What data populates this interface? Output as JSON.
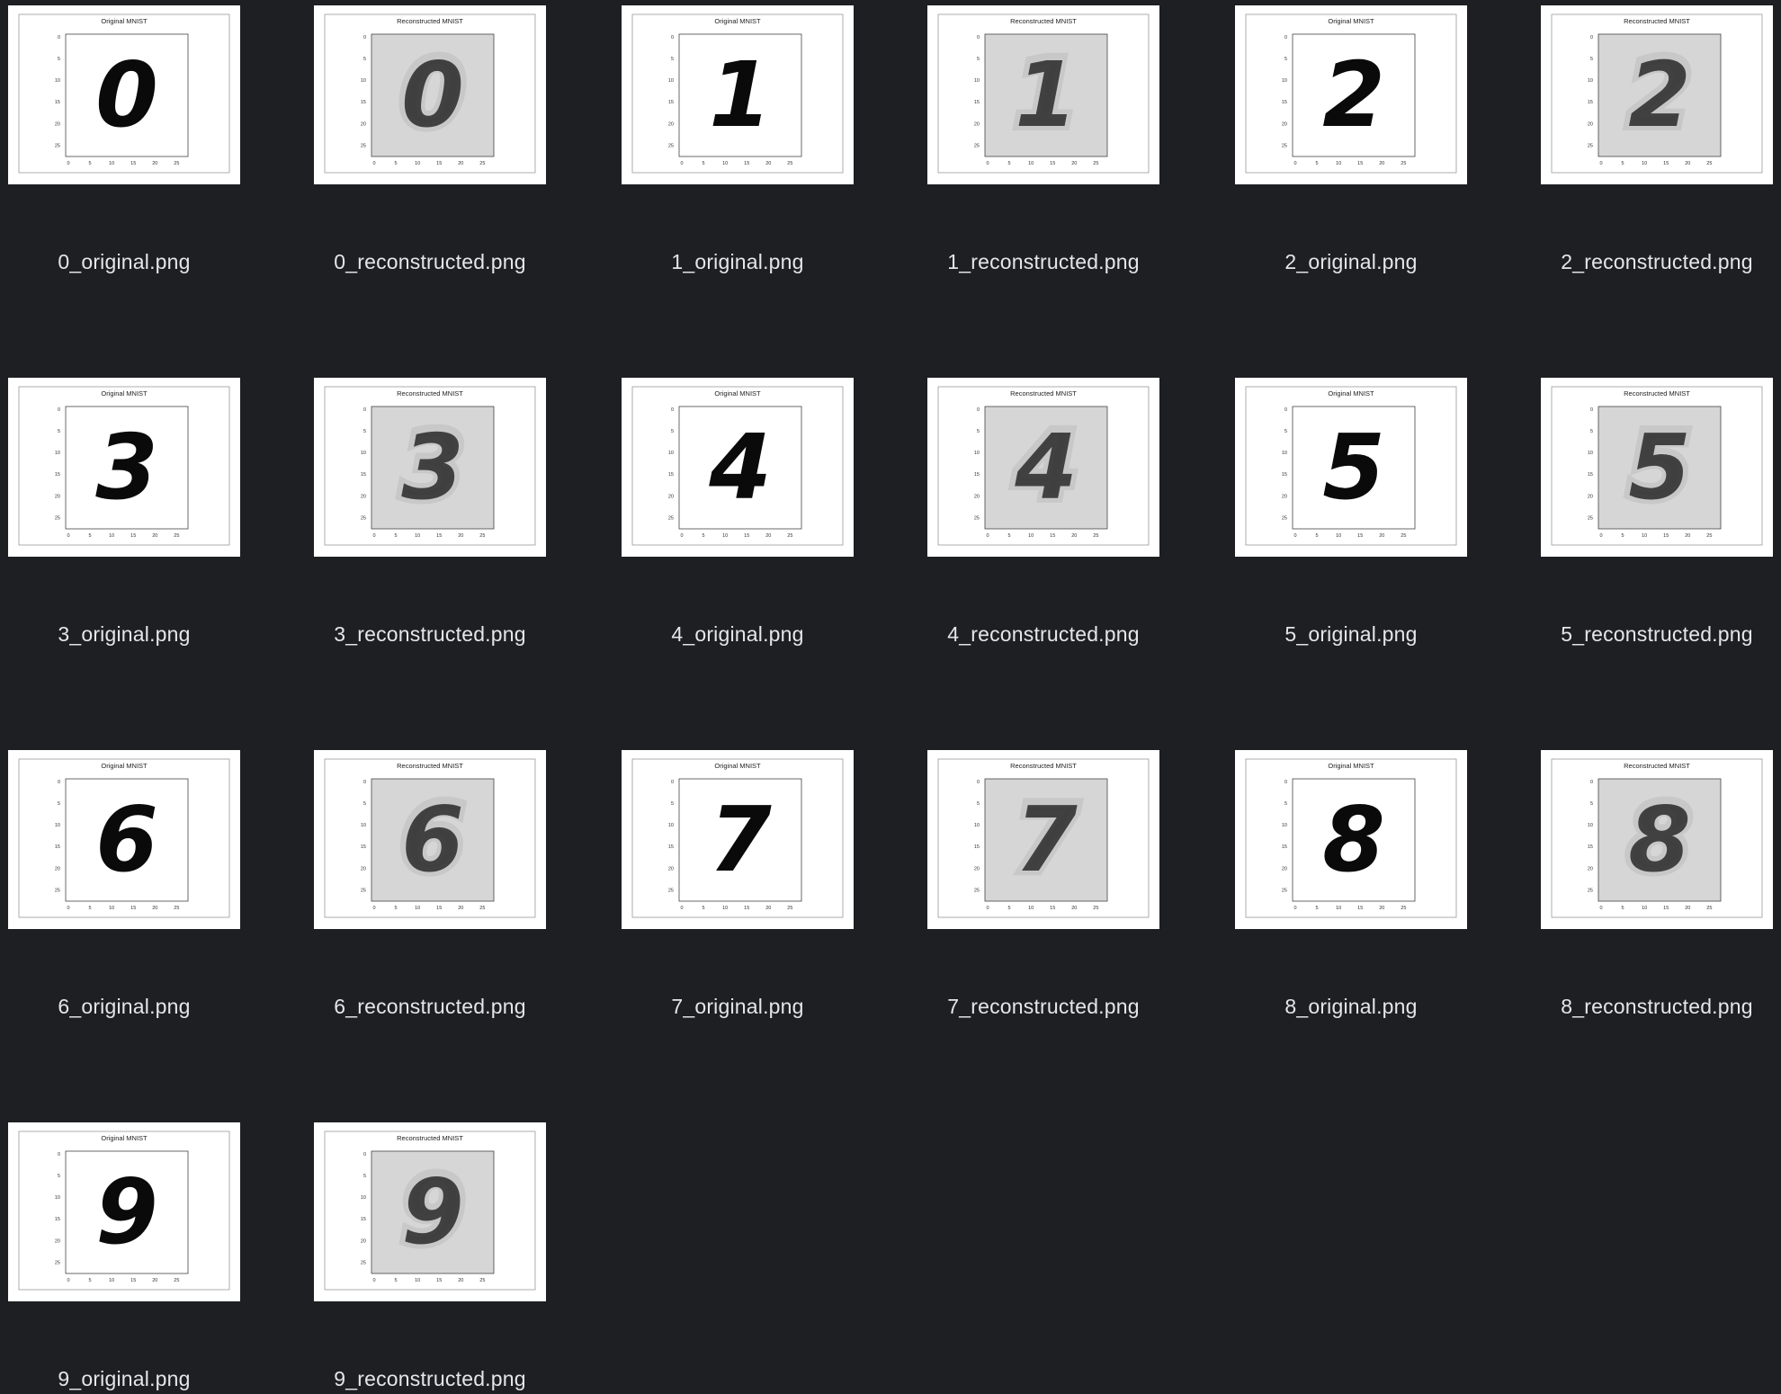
{
  "files": [
    {
      "label": "0_original.png",
      "plot_title": "Original MNIST",
      "digit": "0",
      "kind": "original"
    },
    {
      "label": "0_reconstructed.png",
      "plot_title": "Reconstructed MNIST",
      "digit": "0",
      "kind": "reconstructed"
    },
    {
      "label": "1_original.png",
      "plot_title": "Original MNIST",
      "digit": "1",
      "kind": "original"
    },
    {
      "label": "1_reconstructed.png",
      "plot_title": "Reconstructed MNIST",
      "digit": "1",
      "kind": "reconstructed"
    },
    {
      "label": "2_original.png",
      "plot_title": "Original MNIST",
      "digit": "2",
      "kind": "original"
    },
    {
      "label": "2_reconstructed.png",
      "plot_title": "Reconstructed MNIST",
      "digit": "2",
      "kind": "reconstructed"
    },
    {
      "label": "3_original.png",
      "plot_title": "Original MNIST",
      "digit": "3",
      "kind": "original"
    },
    {
      "label": "3_reconstructed.png",
      "plot_title": "Reconstructed MNIST",
      "digit": "3",
      "kind": "reconstructed"
    },
    {
      "label": "4_original.png",
      "plot_title": "Original MNIST",
      "digit": "4",
      "kind": "original"
    },
    {
      "label": "4_reconstructed.png",
      "plot_title": "Reconstructed MNIST",
      "digit": "4",
      "kind": "reconstructed"
    },
    {
      "label": "5_original.png",
      "plot_title": "Original MNIST",
      "digit": "5",
      "kind": "original"
    },
    {
      "label": "5_reconstructed.png",
      "plot_title": "Reconstructed MNIST",
      "digit": "5",
      "kind": "reconstructed"
    },
    {
      "label": "6_original.png",
      "plot_title": "Original MNIST",
      "digit": "6",
      "kind": "original"
    },
    {
      "label": "6_reconstructed.png",
      "plot_title": "Reconstructed MNIST",
      "digit": "6",
      "kind": "reconstructed"
    },
    {
      "label": "7_original.png",
      "plot_title": "Original MNIST",
      "digit": "7",
      "kind": "original"
    },
    {
      "label": "7_reconstructed.png",
      "plot_title": "Reconstructed MNIST",
      "digit": "7",
      "kind": "reconstructed"
    },
    {
      "label": "8_original.png",
      "plot_title": "Original MNIST",
      "digit": "8",
      "kind": "original"
    },
    {
      "label": "8_reconstructed.png",
      "plot_title": "Reconstructed MNIST",
      "digit": "8",
      "kind": "reconstructed"
    },
    {
      "label": "9_original.png",
      "plot_title": "Original MNIST",
      "digit": "9",
      "kind": "original"
    },
    {
      "label": "9_reconstructed.png",
      "plot_title": "Reconstructed MNIST",
      "digit": "9",
      "kind": "reconstructed"
    }
  ],
  "tick_labels": {
    "x": [
      "0",
      "5",
      "10",
      "15",
      "20",
      "25"
    ],
    "y": [
      "0",
      "5",
      "10",
      "15",
      "20",
      "25"
    ]
  },
  "colors": {
    "background": "#1e1f23",
    "label_text": "#e6e6e8",
    "thumbnail_bg": "#ffffff",
    "original_plot_bg": "#ffffff",
    "reconstructed_plot_bg": "#d6d6d6",
    "ink": "#0a0a0a"
  }
}
